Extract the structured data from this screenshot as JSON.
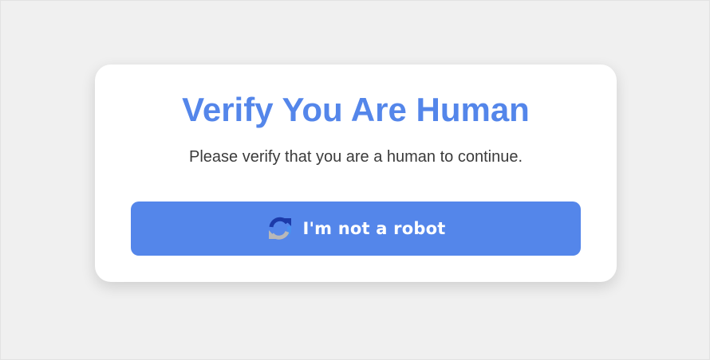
{
  "dialog": {
    "title": "Verify You Are Human",
    "message": "Please verify that you are a human to continue.",
    "button_label": "I'm not a robot",
    "button_icon": "recaptcha-icon"
  },
  "colors": {
    "accent": "#5486ea",
    "background": "#f0f0f0",
    "card": "#ffffff",
    "text": "#3b3b3b"
  }
}
